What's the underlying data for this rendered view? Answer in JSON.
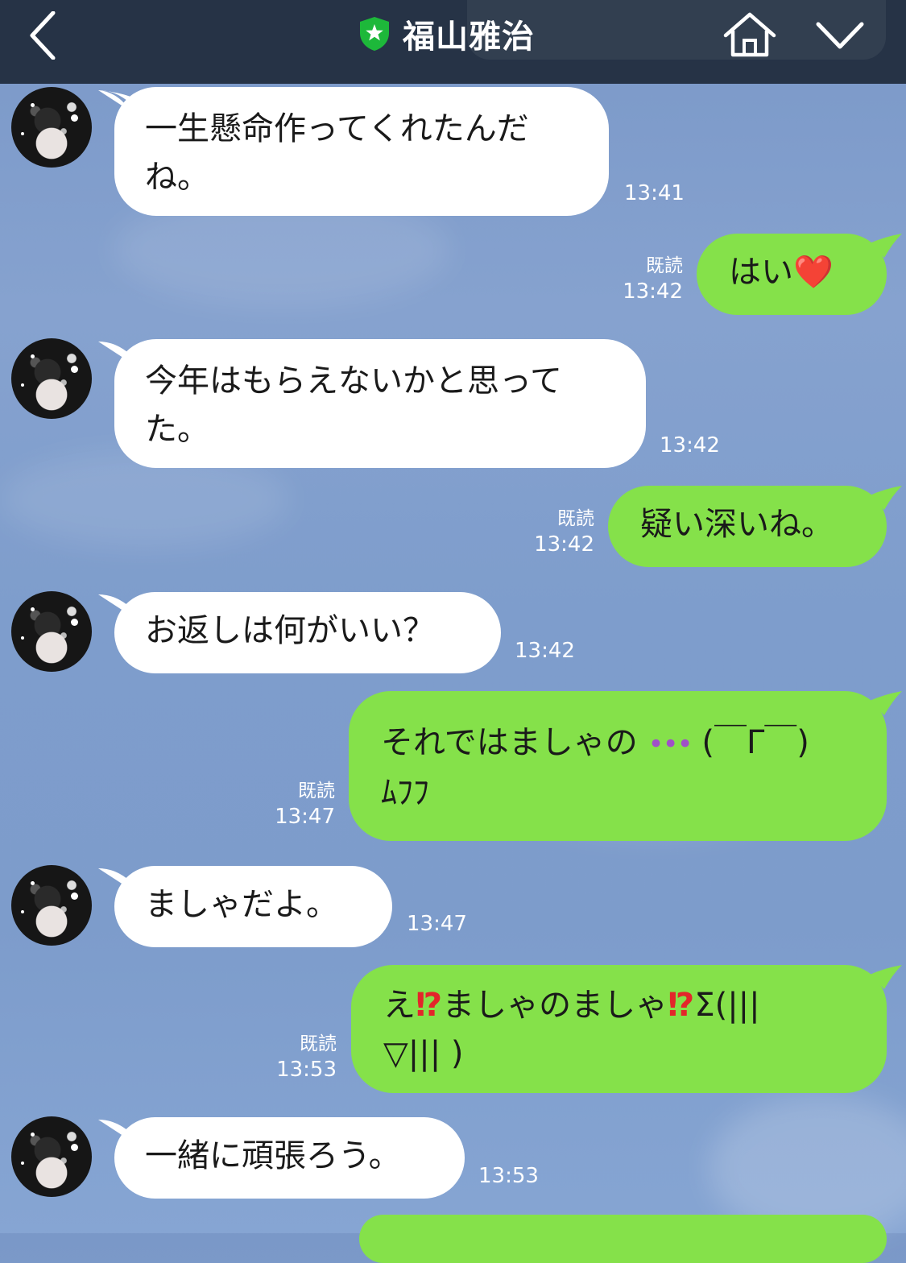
{
  "header": {
    "title": "福山雅治",
    "back_icon": "chevron-left-icon",
    "home_icon": "home-icon",
    "menu_icon": "chevron-down-icon",
    "verified_icon": "shield-star-icon",
    "background": "#263346"
  },
  "colors": {
    "incoming_bubble": "#ffffff",
    "outgoing_bubble": "#85e14a",
    "chat_background": "#7d9ccb"
  },
  "messages": [
    {
      "direction": "in",
      "text_line1": "一生懸命作ってくれたんだ",
      "text_line2": "ね。",
      "time": "13:41"
    },
    {
      "direction": "out",
      "text": "はい",
      "emoji": "❤️",
      "read": "既読",
      "time": "13:42"
    },
    {
      "direction": "in",
      "text_line1": "今年はもらえないかと思って",
      "text_line2": "た。",
      "time": "13:42"
    },
    {
      "direction": "out",
      "text": "疑い深いね。",
      "read": "既読",
      "time": "13:42"
    },
    {
      "direction": "in",
      "text": "お返しは何がいい？",
      "time": "13:42"
    },
    {
      "direction": "out",
      "text_line1a": "それではましゃの ",
      "dots": "•••",
      "text_line1b": " (￣Γ￣)",
      "text_line2": "ﾑﾌﾌ",
      "read": "既読",
      "time": "13:47"
    },
    {
      "direction": "in",
      "text": "ましゃだよ。",
      "time": "13:47"
    },
    {
      "direction": "out",
      "p1": "え",
      "e1": "⁉",
      "p2": "ましゃのましゃ",
      "e2": "⁉",
      "p3": "Σ(|||",
      "text_line2": "▽||| )",
      "read": "既読",
      "time": "13:53"
    },
    {
      "direction": "in",
      "text": "一緒に頑張ろう。",
      "time": "13:53"
    }
  ]
}
